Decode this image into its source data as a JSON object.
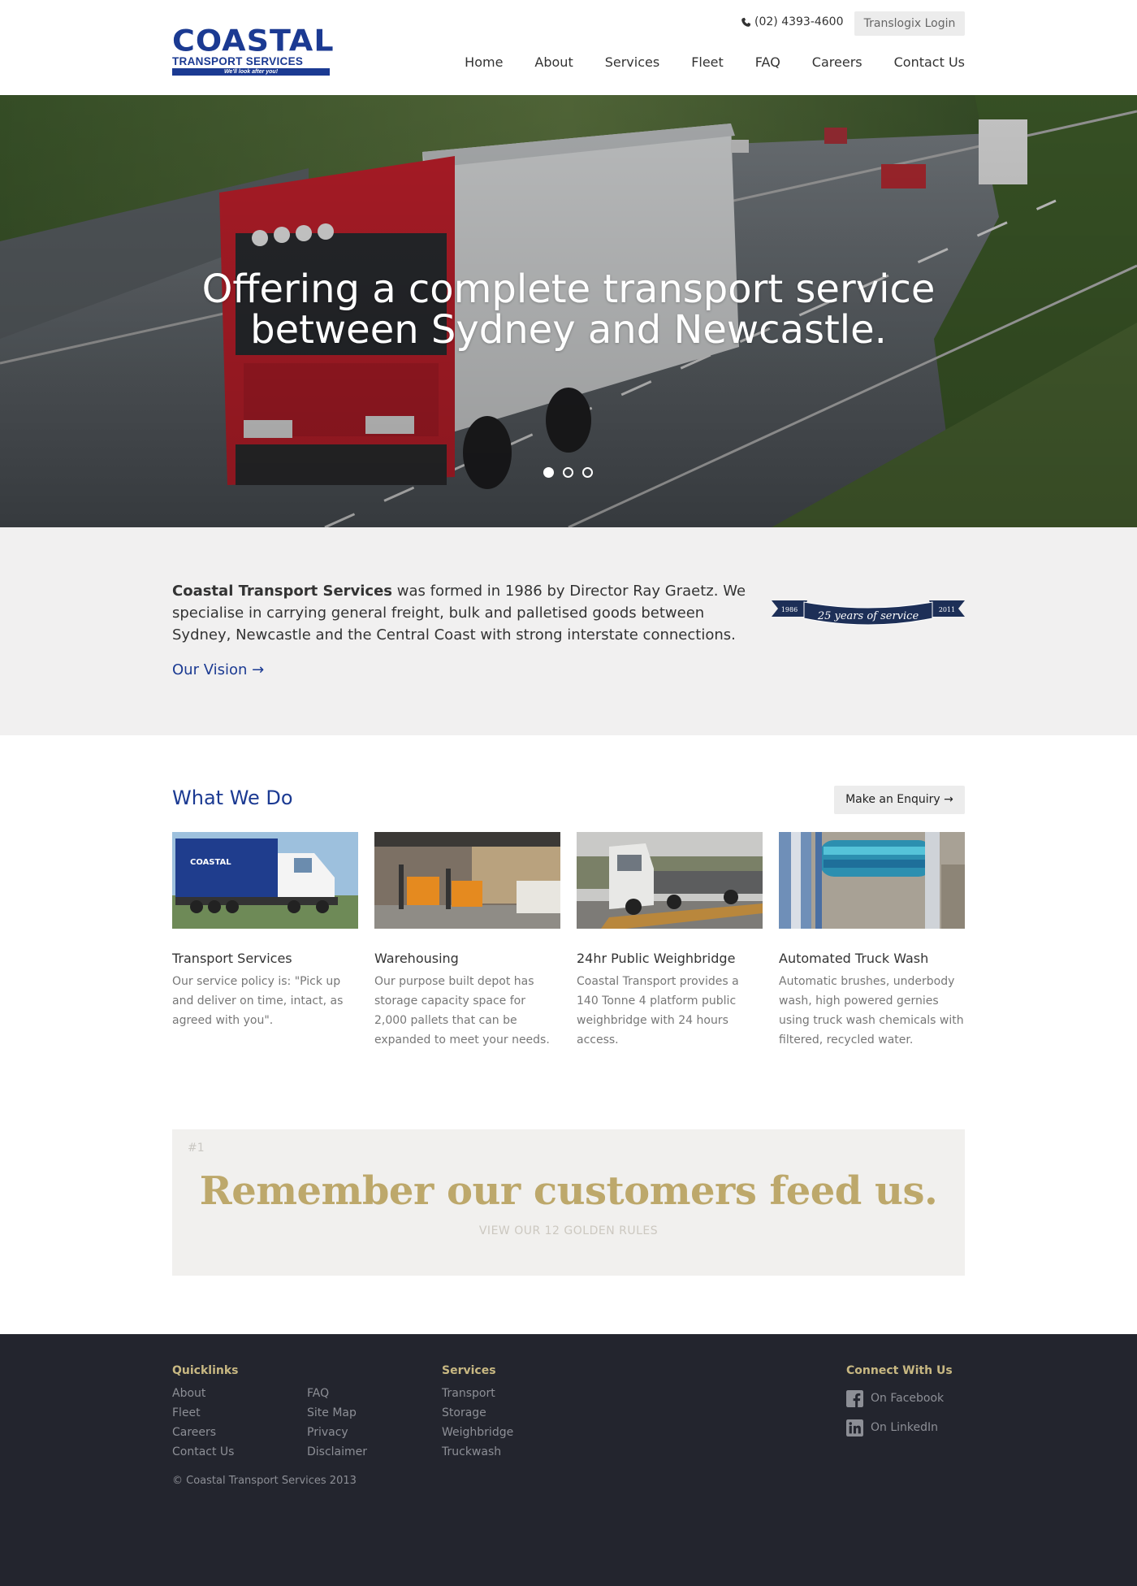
{
  "header": {
    "logo": {
      "word": "COASTAL",
      "sub": "TRANSPORT SERVICES",
      "tagline": "We'll look after you!"
    },
    "phone": "(02) 4393-4600",
    "login_label": "Translogix Login",
    "nav": [
      "Home",
      "About",
      "Services",
      "Fleet",
      "FAQ",
      "Careers",
      "Contact Us"
    ]
  },
  "hero": {
    "title_line1": "Offering a complete transport service",
    "title_line2": "between Sydney and Newcastle.",
    "slides_total": 3,
    "active_slide": 1
  },
  "about": {
    "company": "Coastal Transport Services",
    "text": " was formed in 1986 by Director Ray Graetz. We specialise in carrying general freight, bulk and palletised goods between Sydney, Newcastle and the Central Coast with strong interstate connections.",
    "vision_link": "Our Vision →",
    "ribbon": {
      "left": "1986",
      "center": "25 years of service",
      "right": "2011"
    }
  },
  "what_we_do": {
    "title": "What We Do",
    "enquiry_label": "Make an Enquiry →",
    "cards": [
      {
        "title": "Transport Services",
        "text": "Our service policy is: \"Pick up and deliver on time, intact, as agreed with you\"."
      },
      {
        "title": "Warehousing",
        "text": "Our purpose built depot has storage capacity space for 2,000 pallets that can be expanded to meet your needs."
      },
      {
        "title": "24hr Public Weighbridge",
        "text": "Coastal Transport provides a 140 Tonne 4 platform public weighbridge with 24 hours access."
      },
      {
        "title": "Automated Truck Wash",
        "text": "Automatic brushes, underbody wash, high powered gernies using truck wash chemicals with filtered, recycled water."
      }
    ]
  },
  "quote": {
    "number": "#1",
    "text": "Remember our customers feed us.",
    "link": "VIEW OUR 12 GOLDEN RULES"
  },
  "footer": {
    "quicklinks_head": "Quicklinks",
    "quicklinks_col1": [
      "About",
      "Fleet",
      "Careers",
      "Contact Us"
    ],
    "quicklinks_col2": [
      "FAQ",
      "Site Map",
      "Privacy",
      "Disclaimer"
    ],
    "services_head": "Services",
    "services": [
      "Transport",
      "Storage",
      "Weighbridge",
      "Truckwash"
    ],
    "connect_head": "Connect With Us",
    "facebook": "On Facebook",
    "linkedin": "On LinkedIn",
    "copyright": "© Coastal Transport Services 2013"
  },
  "colors": {
    "brand_blue": "#1b3a92",
    "gold": "#bda86b",
    "footer_bg": "#23252e",
    "light_grey": "#f1f0f0"
  }
}
